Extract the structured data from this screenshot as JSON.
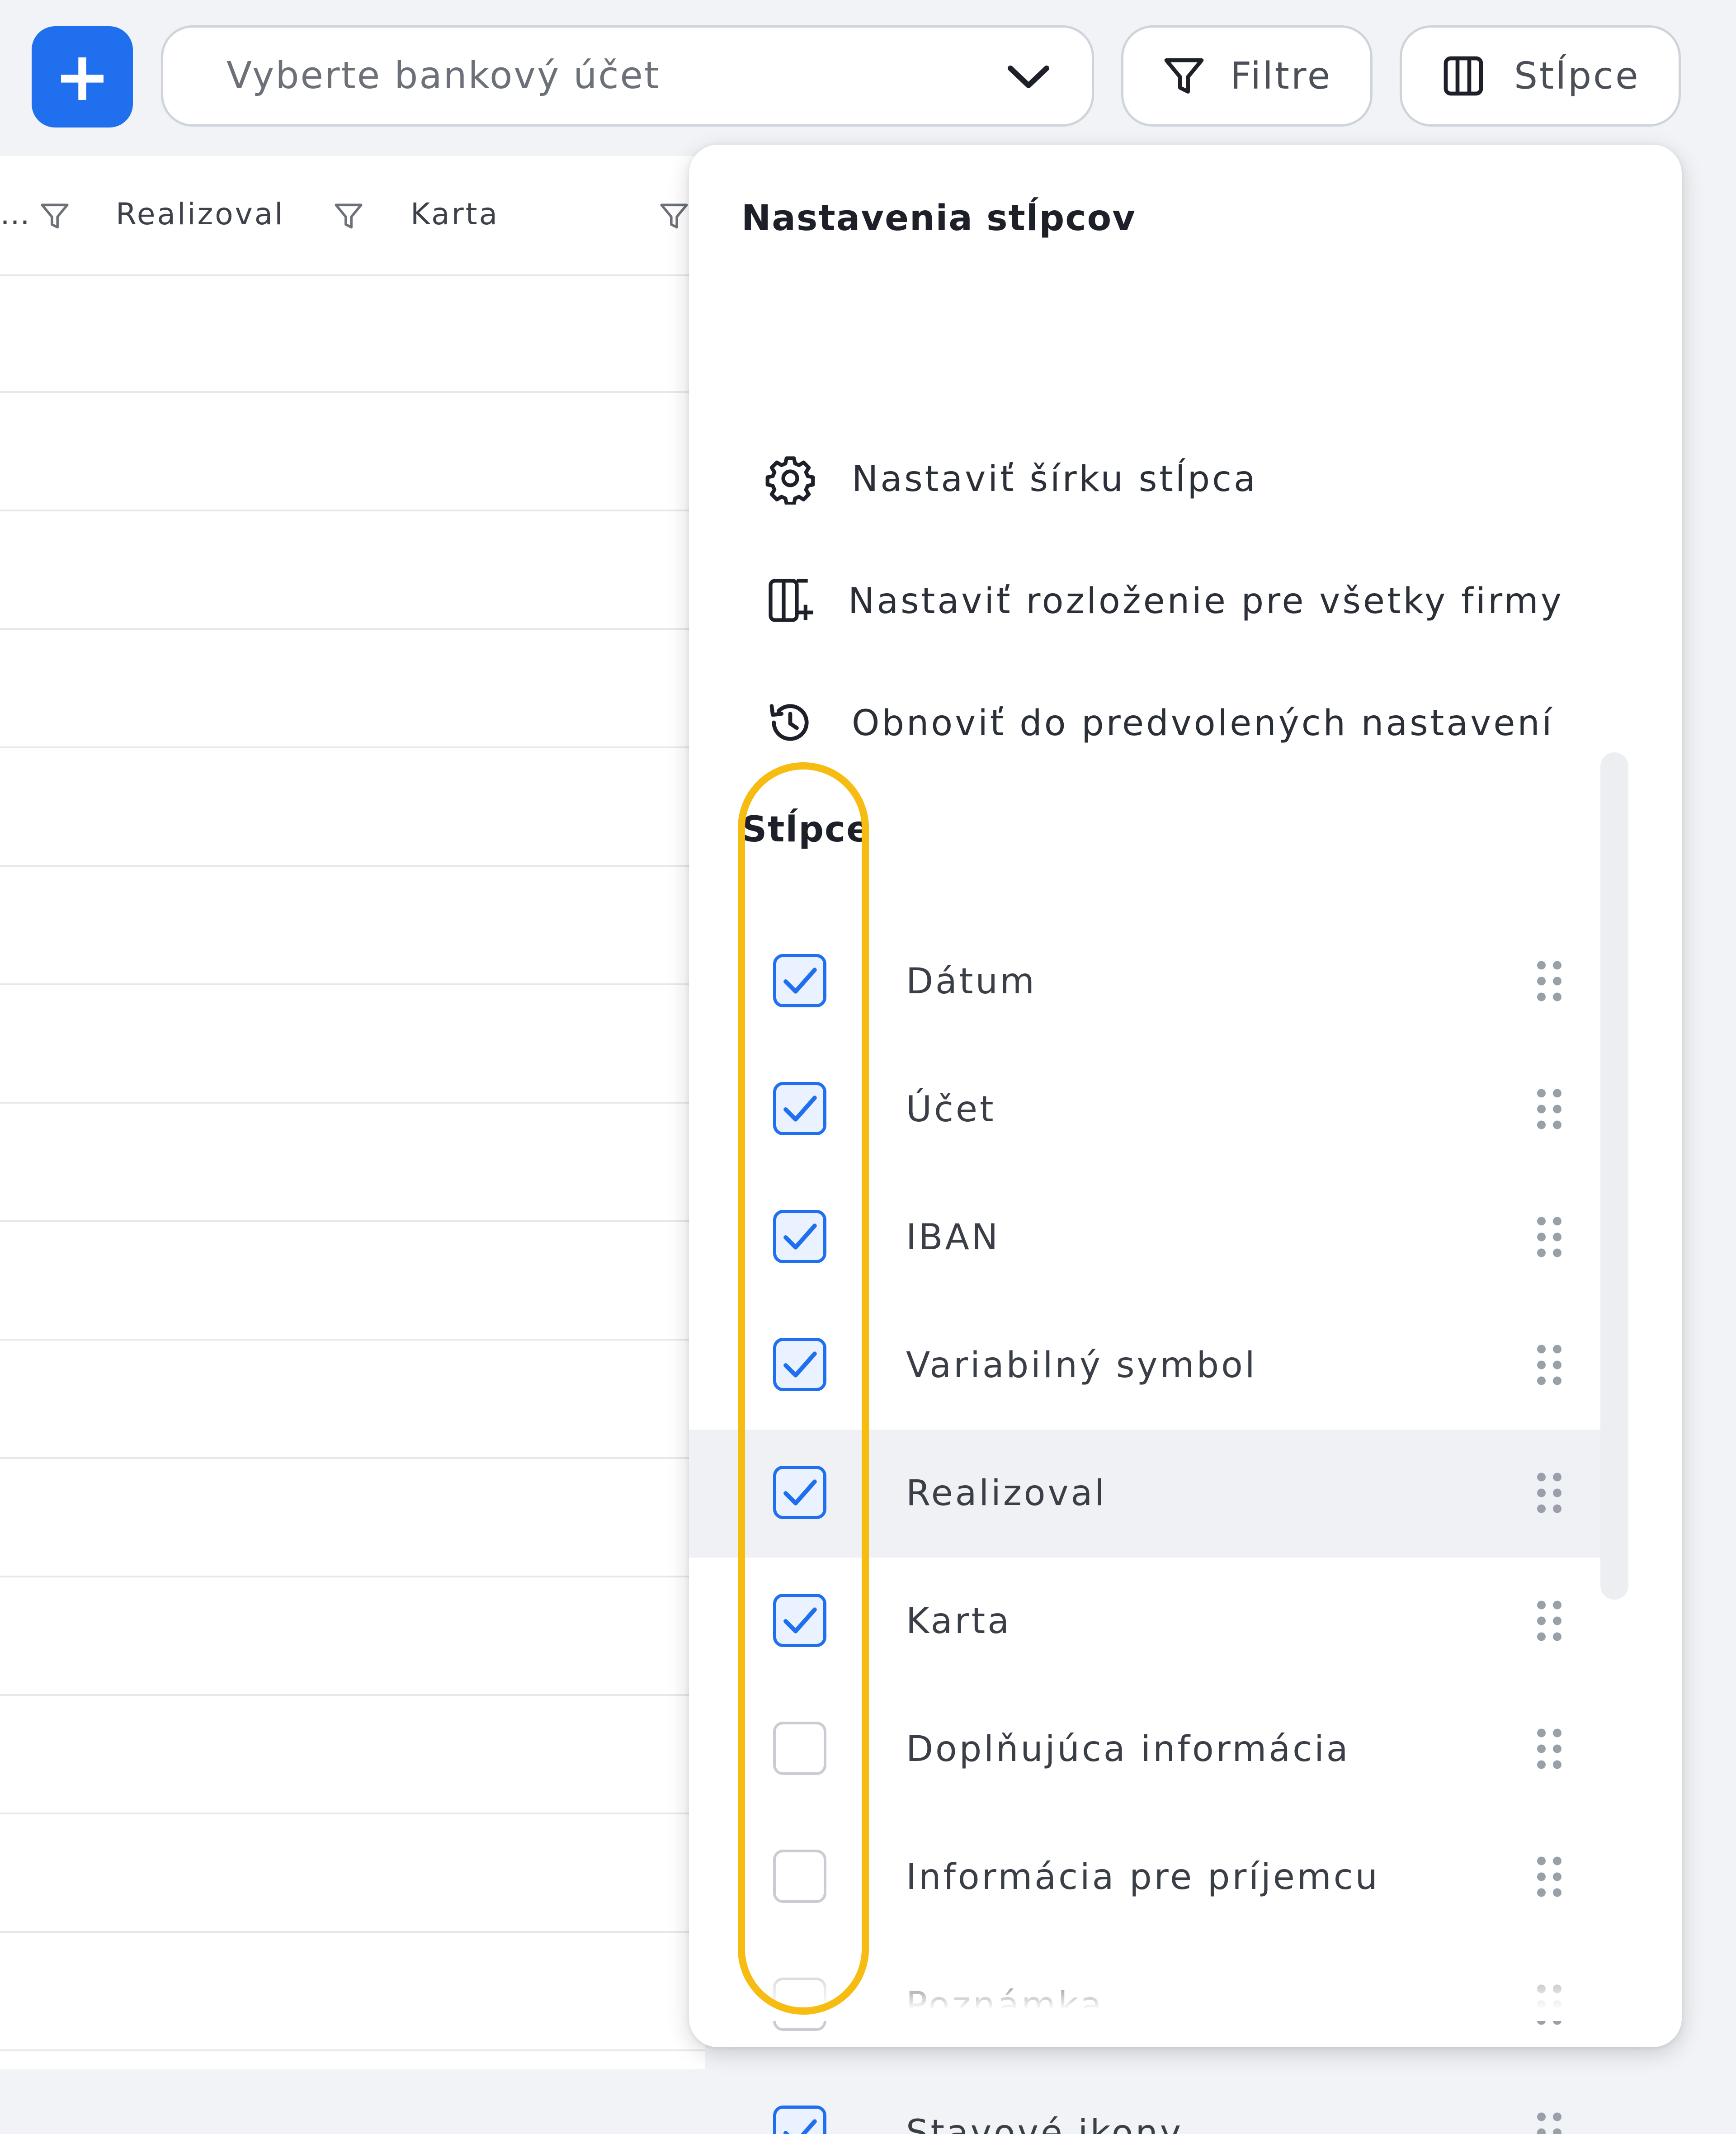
{
  "toolbar": {
    "add_label": "+",
    "account_placeholder": "Vyberte bankový účet",
    "filters_label": "Filtre",
    "columns_label": "Stĺpce"
  },
  "table": {
    "header_ellipsis": "…",
    "headers": [
      "Realizoval",
      "Karta"
    ]
  },
  "panel": {
    "title": "Nastavenia stĺpcov",
    "actions": [
      {
        "label": "Nastaviť šírku stĺpca",
        "icon": "gear-icon"
      },
      {
        "label": "Nastaviť rozloženie pre všetky firmy",
        "icon": "layout-add-icon"
      },
      {
        "label": "Obnoviť do predvolených nastavení",
        "icon": "history-icon"
      }
    ],
    "columns_title": "Stĺpce",
    "columns": [
      {
        "label": "Dátum",
        "checked": true
      },
      {
        "label": "Účet",
        "checked": true
      },
      {
        "label": "IBAN",
        "checked": true
      },
      {
        "label": "Variabilný symbol",
        "checked": true
      },
      {
        "label": "Realizoval",
        "checked": true
      },
      {
        "label": "Karta",
        "checked": true
      },
      {
        "label": "Doplňujúca informácia",
        "checked": false
      },
      {
        "label": "Informácia pre príjemcu",
        "checked": false
      },
      {
        "label": "Poznámka",
        "checked": false
      },
      {
        "label": "Stavové ikony",
        "checked": true
      }
    ]
  },
  "colors": {
    "accent": "#1f6fef",
    "highlight": "#f6bc12",
    "row_hover": "#eff1f5"
  }
}
